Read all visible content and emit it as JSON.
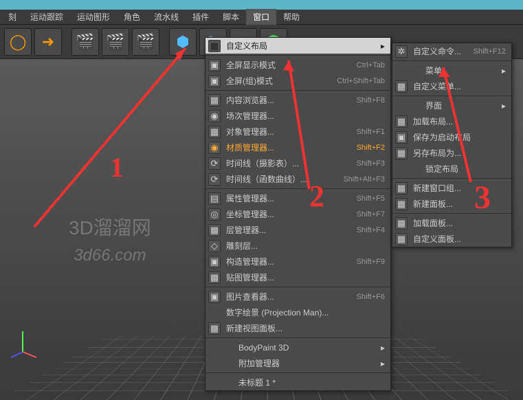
{
  "menubar": {
    "items": [
      "刻",
      "运动跟踪",
      "运动图形",
      "角色",
      "流水线",
      "插件",
      "脚本",
      "窗口",
      "帮助"
    ],
    "active": 7
  },
  "menu1": {
    "items": [
      {
        "icon": "▦",
        "label": "自定义布局",
        "shortcut": "",
        "arrow": true,
        "highlight": true
      },
      {
        "sep": true
      },
      {
        "icon": "▣",
        "label": "全屏显示模式",
        "shortcut": "Ctrl+Tab"
      },
      {
        "icon": "▣",
        "label": "全屏(组)模式",
        "shortcut": "Ctrl+Shift+Tab"
      },
      {
        "sep": true
      },
      {
        "icon": "▦",
        "label": "内容浏览器...",
        "shortcut": "Shift+F8"
      },
      {
        "icon": "◉",
        "label": "场次管理器...",
        "shortcut": ""
      },
      {
        "icon": "▦",
        "label": "对象管理器...",
        "shortcut": "Shift+F1"
      },
      {
        "icon": "◉",
        "label": "材质管理器...",
        "shortcut": "Shift+F2",
        "yellow": true
      },
      {
        "icon": "⟳",
        "label": "时间线（摄影表）...",
        "shortcut": "Shift+F3"
      },
      {
        "icon": "⟳",
        "label": "时间线（函数曲线）...",
        "shortcut": "Shift+Alt+F3"
      },
      {
        "sep": true
      },
      {
        "icon": "▤",
        "label": "属性管理器...",
        "shortcut": "Shift+F5"
      },
      {
        "icon": "◎",
        "label": "坐标管理器...",
        "shortcut": "Shift+F7"
      },
      {
        "icon": "▦",
        "label": "层管理器...",
        "shortcut": "Shift+F4"
      },
      {
        "icon": "◇",
        "label": "雕刻层...",
        "shortcut": ""
      },
      {
        "icon": "▣",
        "label": "构造管理器...",
        "shortcut": "Shift+F9"
      },
      {
        "icon": "▩",
        "label": "贴图管理器...",
        "shortcut": ""
      },
      {
        "sep": true
      },
      {
        "icon": "▣",
        "label": "图片查看器...",
        "shortcut": "Shift+F6"
      },
      {
        "icon": "",
        "label": "数字绘景 (Projection Man)...",
        "shortcut": ""
      },
      {
        "icon": "▦",
        "label": "新建视图面板...",
        "shortcut": ""
      },
      {
        "sep": true
      },
      {
        "icon": "",
        "label": "BodyPaint 3D",
        "shortcut": "",
        "arrow": true,
        "indent": true
      },
      {
        "icon": "",
        "label": "附加管理器",
        "shortcut": "",
        "arrow": true,
        "indent": true
      },
      {
        "sep": true
      },
      {
        "icon": "",
        "label": "未标题 1 *",
        "shortcut": "",
        "indent": true
      }
    ]
  },
  "menu2": {
    "items": [
      {
        "icon": "✲",
        "label": "自定义命令...",
        "shortcut": "Shift+F12"
      },
      {
        "sep": true
      },
      {
        "icon": "",
        "label": "菜单",
        "arrow": true,
        "indent": true
      },
      {
        "icon": "▦",
        "label": "自定义菜单..."
      },
      {
        "sep": true
      },
      {
        "icon": "",
        "label": "界面",
        "arrow": true,
        "indent": true
      },
      {
        "icon": "▦",
        "label": "加载布局..."
      },
      {
        "icon": "▣",
        "label": "保存为启动布局"
      },
      {
        "icon": "▦",
        "label": "另存布局为..."
      },
      {
        "icon": "",
        "label": "锁定布局",
        "indent": true
      },
      {
        "sep": true
      },
      {
        "icon": "▦",
        "label": "新建窗口组..."
      },
      {
        "icon": "▦",
        "label": "新建面板..."
      },
      {
        "sep": true
      },
      {
        "icon": "▦",
        "label": "加载面板..."
      },
      {
        "icon": "▦",
        "label": "自定义面板..."
      }
    ]
  },
  "watermark": {
    "line1": "3D溜溜网",
    "line2": "3d66.com"
  },
  "annotations": {
    "n1": "1",
    "n2": "2",
    "n3": "3"
  }
}
